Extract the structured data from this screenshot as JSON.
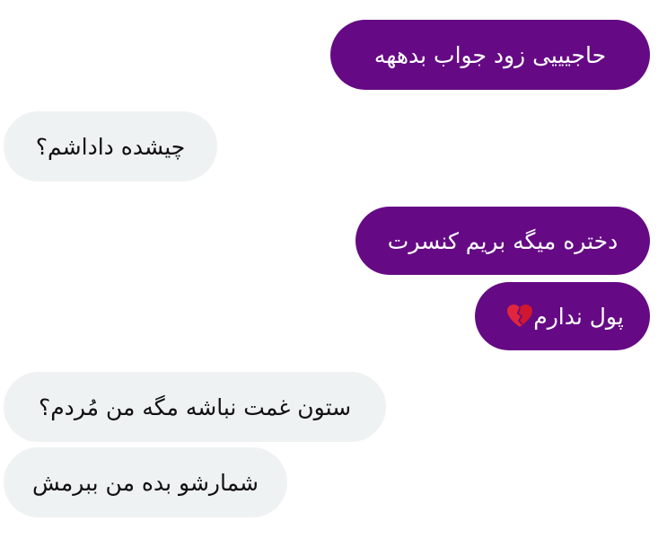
{
  "chat": {
    "messages": [
      {
        "side": "sent",
        "text": "حاجیییی زود جواب بدههه"
      },
      {
        "side": "received",
        "text": "چیشده داداشم؟"
      },
      {
        "side": "sent",
        "text": "دختره میگه بریم کنسرت"
      },
      {
        "side": "sent",
        "text": "پول ندارم",
        "icon": "broken-heart-icon"
      },
      {
        "side": "received",
        "text": "ستون غمت نباشه مگه من مُردم؟"
      },
      {
        "side": "received",
        "text": "شمارشو بده من ببرمش"
      }
    ]
  },
  "colors": {
    "sent_bubble": "#650a84",
    "received_bubble": "#eef2f3",
    "sent_text": "#ffffff",
    "received_text": "#111111"
  }
}
